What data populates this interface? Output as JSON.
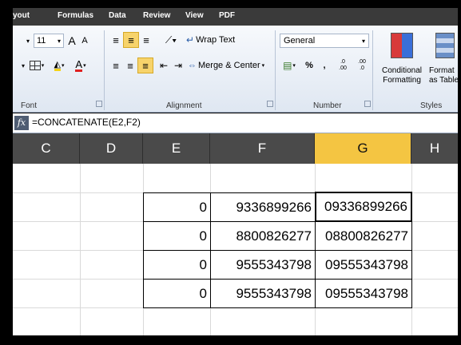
{
  "tabs": [
    "yout",
    "Formulas",
    "Data",
    "Review",
    "View",
    "PDF"
  ],
  "ribbon": {
    "font": {
      "size": "11",
      "group_label": "Font",
      "grow_label": "A",
      "shrink_label": "A",
      "font_color_label": "A"
    },
    "alignment": {
      "wrap_text": "Wrap Text",
      "merge_center": "Merge & Center",
      "group_label": "Alignment"
    },
    "number": {
      "format": "General",
      "percent": "%",
      "comma": ",",
      "inc_decimal": ".00",
      "dec_decimal": ".0",
      "group_label": "Number"
    },
    "styles": {
      "conditional": [
        "Conditional",
        "Formatting"
      ],
      "format_table": [
        "Format",
        "as Table"
      ],
      "group_label": "Styles"
    }
  },
  "formula_bar": {
    "fx": "fx",
    "formula": "=CONCATENATE(E2,F2)"
  },
  "columns": [
    "C",
    "D",
    "E",
    "F",
    "G",
    "H"
  ],
  "selected_column": "G",
  "rows": [
    {
      "E": "0",
      "F": "9336899266",
      "G": "09336899266"
    },
    {
      "E": "0",
      "F": "8800826277",
      "G": "08800826277"
    },
    {
      "E": "0",
      "F": "9555343798",
      "G": "09555343798"
    },
    {
      "E": "0",
      "F": "9555343798",
      "G": "09555343798"
    }
  ]
}
